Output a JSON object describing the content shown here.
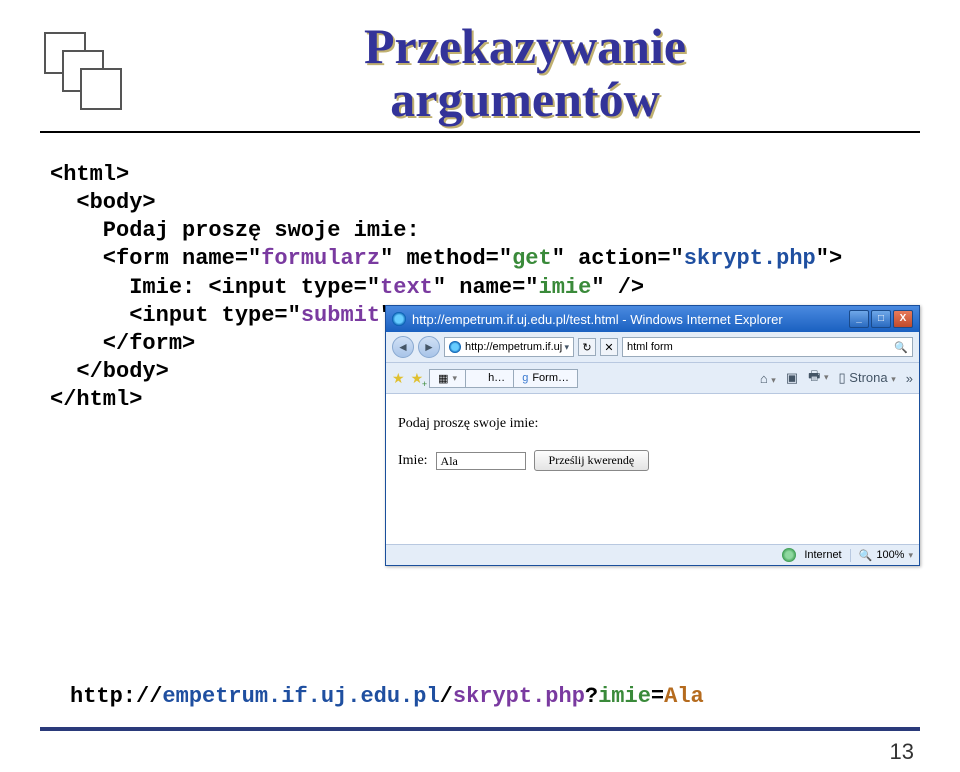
{
  "title": {
    "line1": "Przekazywanie",
    "line2": "argumentów"
  },
  "code": {
    "l1a": "<html>",
    "l2a": "  <body>",
    "l3a": "    Podaj proszę swoje imie:",
    "l4a": "    <form name=\"",
    "l4b": "formularz",
    "l4c": "\" method=\"",
    "l4d": "get",
    "l4e": "\" action=\"",
    "l4f": "skrypt.php",
    "l4g": "\">",
    "l5a": "      Imie: <input type=\"",
    "l5b": "text",
    "l5c": "\" name=\"",
    "l5d": "imie",
    "l5e": "\" />",
    "l6a": "      <input type=\"",
    "l6b": "submit",
    "l6c": "\" />",
    "l7a": "    </form>",
    "l8a": "  </body>",
    "l9a": "</html>"
  },
  "browser": {
    "title": "http://empetrum.if.uj.edu.pl/test.html - Windows Internet Explorer",
    "min": "_",
    "max": "□",
    "close": "X",
    "address": "http://empetrum.if.uj",
    "refresh": "↻",
    "stop": "✕",
    "search": "html form",
    "tab1": "h…",
    "tab2": "Form…",
    "strona": "Strona",
    "chevrons": "»",
    "prompt": "Podaj proszę swoje imie:",
    "imie_label": "Imie:",
    "imie_value": "Ala",
    "submit_label": "Prześlij kwerendę",
    "status_zone": "Internet",
    "zoom": "100%"
  },
  "url": {
    "p1": "http://",
    "p2": "empetrum.if.uj.edu.pl",
    "p3": "/",
    "p4": "skrypt.php",
    "p5": "?",
    "p6": "imie",
    "p7": "=",
    "p8": "Ala"
  },
  "pagenum": "13"
}
